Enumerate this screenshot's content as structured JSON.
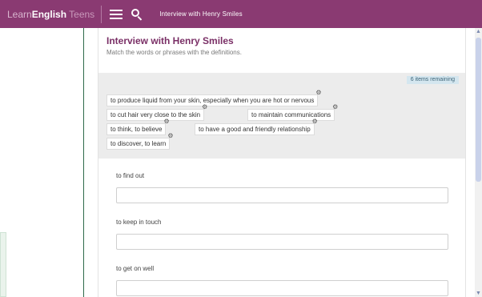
{
  "header": {
    "logo_prefix": "Learn",
    "logo_bold": "English",
    "logo_suffix": " Teens",
    "page_label": "Interview with Henry Smiles",
    "icons": [
      "menu-icon",
      "search-icon"
    ]
  },
  "exercise": {
    "title": "Interview with Henry Smiles",
    "instructions": "Match the words or phrases with the definitions.",
    "remaining": "6 items remaining",
    "options": [
      "to produce liquid from your skin, especially when you are hot or nervous",
      "to cut hair very close to the skin",
      "to maintain communications",
      "to think, to believe",
      "to have a good and friendly relationship",
      "to discover, to learn"
    ],
    "questions": [
      {
        "label": "to find out",
        "value": ""
      },
      {
        "label": "to keep in touch",
        "value": ""
      },
      {
        "label": "to get on well",
        "value": ""
      }
    ]
  },
  "colors": {
    "brand": "#8a3a72",
    "title": "#7a2f66",
    "bank_bg": "#ececec",
    "badge_bg": "#d4e6ef"
  }
}
